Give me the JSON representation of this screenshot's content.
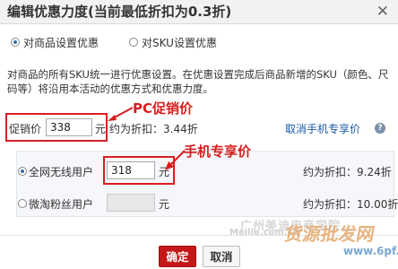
{
  "header": {
    "title": "编辑优惠力度(当前最低折扣为0.3折)",
    "close_icon": "close-icon"
  },
  "mode": {
    "options": [
      {
        "label": "对商品设置优惠",
        "checked": true
      },
      {
        "label": "对SKU设置优惠",
        "checked": false
      }
    ]
  },
  "description": "对商品的所有SKU统一进行优惠设置。在优惠设置完成后商品新增的SKU（颜色、尺码等）将沿用本活动的优惠方式和优惠力度。",
  "promo": {
    "label": "促销价",
    "value": "338",
    "unit": "元",
    "discount_text": "约为折扣：3.44折",
    "cancel_mobile_link": "取消手机专享价"
  },
  "annotations": {
    "pc": "PC促销价",
    "mobile": "手机专享价"
  },
  "mobile": {
    "rows": [
      {
        "label": "全网无线用户",
        "value": "318",
        "unit": "元",
        "discount_text": "约为折扣：9.24折",
        "checked": true,
        "enabled": true
      },
      {
        "label": "微淘粉丝用户",
        "value": "",
        "unit": "元",
        "discount_text": "约为折扣：10.00折",
        "checked": false,
        "enabled": false
      }
    ]
  },
  "footer": {
    "ok_label": "确定",
    "cancel_label": "取消"
  },
  "watermark": {
    "line1": "广州美迪电商学院",
    "line2": "Meilie.com.cn",
    "line3": "货源批发网",
    "line4": "www.6pf.cn"
  }
}
